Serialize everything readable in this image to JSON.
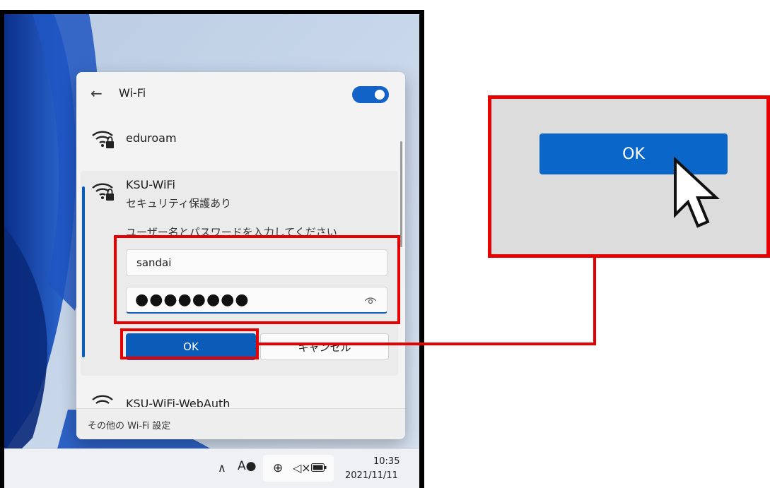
{
  "flyout": {
    "back_icon": "back-arrow-icon",
    "title": "Wi-Fi",
    "toggle_state": "on",
    "networks": [
      {
        "name": "eduroam",
        "icon": "wifi-secured-icon"
      },
      {
        "name": "KSU-WiFi",
        "status": "セキュリティ保護あり",
        "prompt": "ユーザー名とパスワードを入力してください",
        "username": "sandai",
        "password_mask": "●●●●●●●●",
        "ok_label": "OK",
        "cancel_label": "キャンセル"
      },
      {
        "name": "KSU-WiFi-WebAuth"
      }
    ],
    "footer_link": "その他の Wi-Fi 設定"
  },
  "taskbar": {
    "time": "10:35",
    "date": "2021/11/11",
    "icons": [
      "chevron-up-icon",
      "font-input-icon",
      "globe-network-icon",
      "volume-muted-icon",
      "battery-icon"
    ]
  },
  "zoom": {
    "ok_label": "OK"
  },
  "colors": {
    "accent": "#0a5cb8",
    "highlight": "#e60000",
    "zoom_background": "#dcdcdc"
  }
}
